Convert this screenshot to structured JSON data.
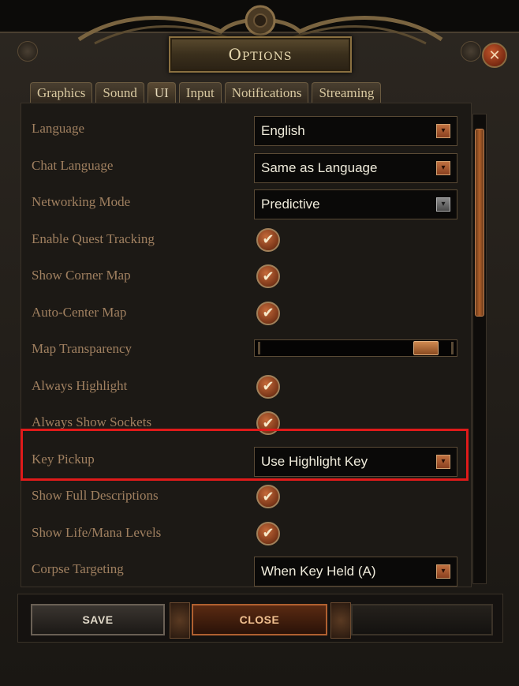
{
  "window": {
    "title": "Options",
    "close_symbol": "✕"
  },
  "tabs": [
    {
      "label": "Graphics",
      "active": false
    },
    {
      "label": "Sound",
      "active": false
    },
    {
      "label": "UI",
      "active": true
    },
    {
      "label": "Input",
      "active": false
    },
    {
      "label": "Notifications",
      "active": false
    },
    {
      "label": "Streaming",
      "active": false
    }
  ],
  "settings": [
    {
      "label": "Language",
      "control": "dropdown",
      "value": "English"
    },
    {
      "label": "Chat Language",
      "control": "dropdown",
      "value": "Same as Language"
    },
    {
      "label": "Networking Mode",
      "control": "dropdown",
      "value": "Predictive",
      "arrow": "gray"
    },
    {
      "label": "Enable Quest Tracking",
      "control": "checkbox",
      "checked": true
    },
    {
      "label": "Show Corner Map",
      "control": "checkbox",
      "checked": true
    },
    {
      "label": "Auto-Center Map",
      "control": "checkbox",
      "checked": true
    },
    {
      "label": "Map Transparency",
      "control": "slider",
      "level": 0.92
    },
    {
      "label": "Always Highlight",
      "control": "checkbox",
      "checked": true
    },
    {
      "label": "Always Show Sockets",
      "control": "checkbox",
      "checked": true
    },
    {
      "label": "Key Pickup",
      "control": "dropdown",
      "value": "Use Highlight Key",
      "highlighted": true
    },
    {
      "label": "Show Full Descriptions",
      "control": "checkbox",
      "checked": true
    },
    {
      "label": "Show Life/Mana Levels",
      "control": "checkbox",
      "checked": true
    },
    {
      "label": "Corpse Targeting",
      "control": "dropdown",
      "value": "When Key Held (A)"
    }
  ],
  "check_symbol": "✔",
  "dropdown_arrow_symbol": "▾",
  "buttons": {
    "save": "SAVE",
    "close": "CLOSE"
  },
  "colors": {
    "highlight": "#e01a1a",
    "label": "#a08060",
    "value": "#f0ecdc"
  }
}
